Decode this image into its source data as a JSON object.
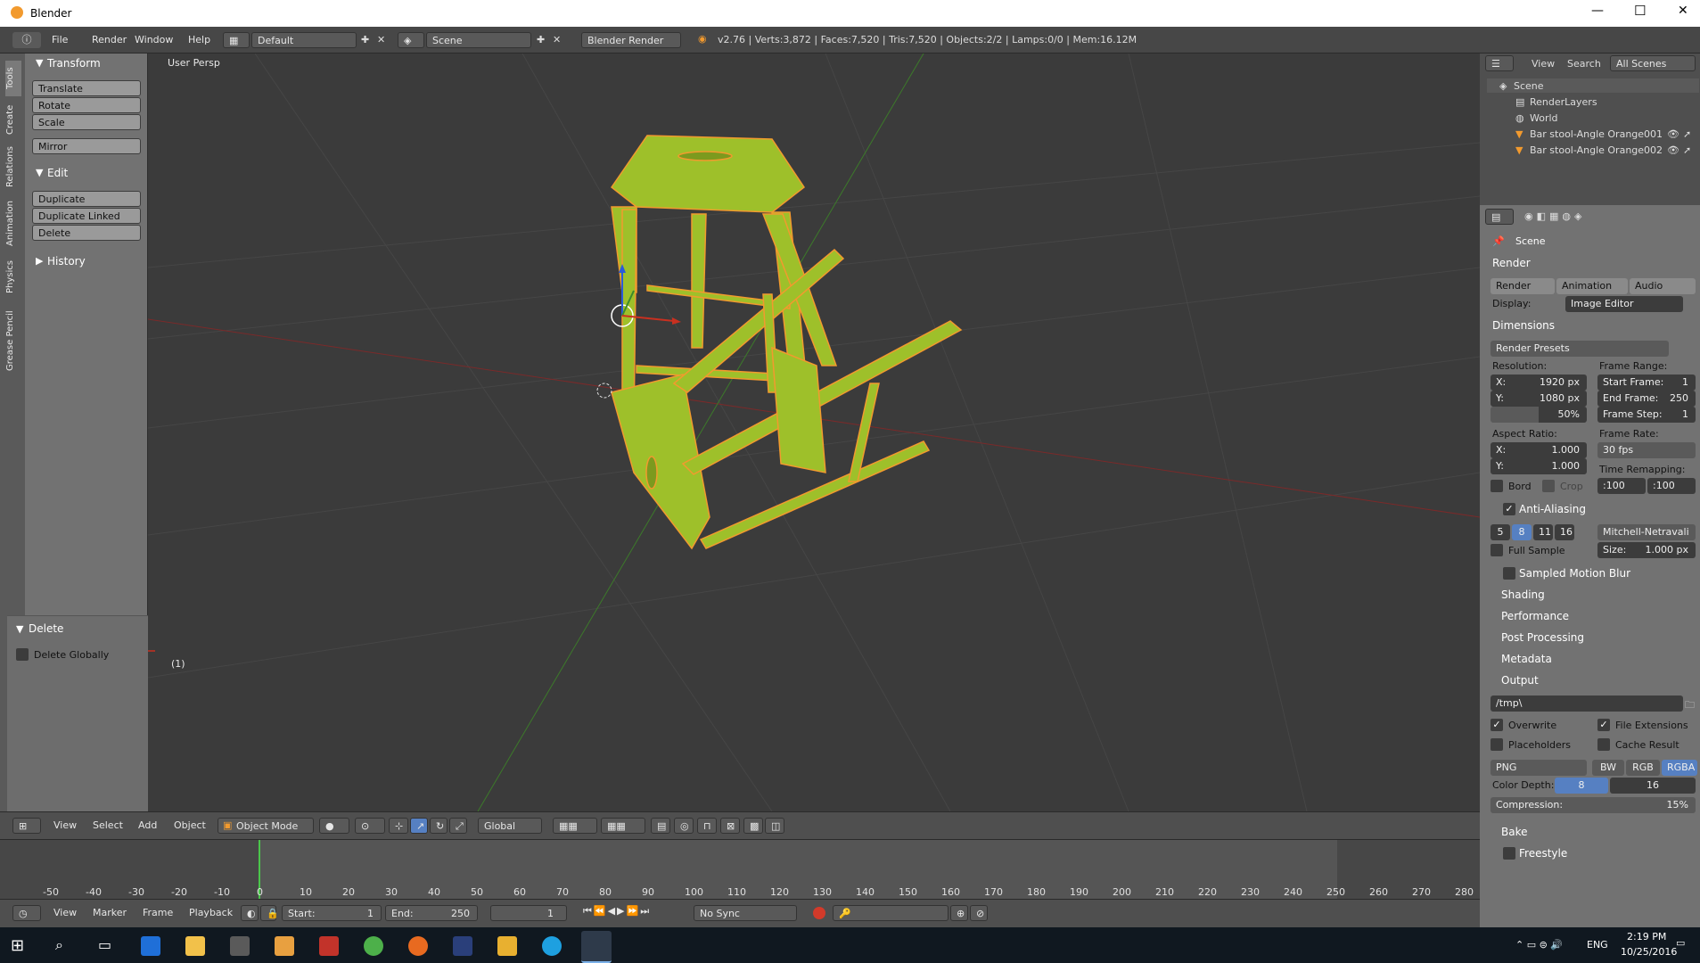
{
  "window": {
    "title": "Blender",
    "min": "—",
    "max": "☐",
    "close": "✕"
  },
  "topmenu": {
    "items": [
      "File",
      "Render",
      "Window",
      "Help"
    ],
    "layout": "Default",
    "scene": "Scene",
    "engine": "Blender Render",
    "stats": "v2.76 | Verts:3,872 | Faces:7,520 | Tris:7,520 | Objects:2/2 | Lamps:0/0 | Mem:16.12M"
  },
  "toolshelf": {
    "tabs": [
      "Tools",
      "Create",
      "Relations",
      "Animation",
      "Physics",
      "Grease Pencil"
    ],
    "transform_title": "Transform",
    "transform_buttons": [
      "Translate",
      "Rotate",
      "Scale"
    ],
    "mirror": "Mirror",
    "edit_title": "Edit",
    "edit_buttons": [
      "Duplicate",
      "Duplicate Linked",
      "Delete"
    ],
    "history_title": "History",
    "op_title": "Delete",
    "op_option": "Delete Globally"
  },
  "viewport": {
    "label": "User Persp",
    "frame": "(1)"
  },
  "vpfooter": {
    "items": [
      "View",
      "Select",
      "Add",
      "Object"
    ],
    "mode": "Object Mode",
    "orientation": "Global"
  },
  "timeline": {
    "ticks": [
      "-50",
      "-40",
      "-30",
      "-20",
      "-10",
      "0",
      "10",
      "20",
      "30",
      "40",
      "50",
      "60",
      "70",
      "80",
      "90",
      "100",
      "110",
      "120",
      "130",
      "140",
      "150",
      "160",
      "170",
      "180",
      "190",
      "200",
      "210",
      "220",
      "230",
      "240",
      "250",
      "260",
      "270",
      "280"
    ],
    "items": [
      "View",
      "Marker",
      "Frame",
      "Playback"
    ],
    "start_label": "Start:",
    "start": "1",
    "end_label": "End:",
    "end": "250",
    "current": "1",
    "sync": "No Sync"
  },
  "outliner": {
    "menu": [
      "View",
      "Search"
    ],
    "filter": "All Scenes",
    "items": [
      "Scene",
      "RenderLayers",
      "World",
      "Bar stool-Angle Orange001",
      "Bar stool-Angle Orange002"
    ]
  },
  "properties": {
    "context": "Scene",
    "render_section": "Render",
    "render_buttons": [
      "Render",
      "Animation",
      "Audio"
    ],
    "display_label": "Display:",
    "display_value": "Image Editor",
    "dimensions": "Dimensions",
    "presets": "Render Presets",
    "resolution_label": "Resolution:",
    "res_x": "X:",
    "res_x_val": "1920 px",
    "res_y": "Y:",
    "res_y_val": "1080 px",
    "res_pct": "50%",
    "frame_range_label": "Frame Range:",
    "start_frame": "Start Frame:",
    "start_frame_val": "1",
    "end_frame": "End Frame:",
    "end_frame_val": "250",
    "frame_step": "Frame Step:",
    "frame_step_val": "1",
    "aspect_label": "Aspect Ratio:",
    "asp_x": "X:",
    "asp_x_val": "1.000",
    "asp_y": "Y:",
    "asp_y_val": "1.000",
    "frame_rate_label": "Frame Rate:",
    "fps": "30 fps",
    "time_remap": "Time Remapping:",
    "remap_old": ":100",
    "remap_new": ":100",
    "bord": "Bord",
    "crop": "Crop",
    "aa": "Anti-Aliasing",
    "aa_samples": [
      "5",
      "8",
      "11",
      "16"
    ],
    "aa_filter": "Mitchell-Netravali",
    "full_sample": "Full Sample",
    "size_label": "Size:",
    "size_val": "1.000 px",
    "collapsed": [
      "Sampled Motion Blur",
      "Shading",
      "Performance",
      "Post Processing",
      "Metadata"
    ],
    "output": "Output",
    "path": "/tmp\\",
    "overwrite": "Overwrite",
    "file_ext": "File Extensions",
    "placeholders": "Placeholders",
    "cache": "Cache Result",
    "format": "PNG",
    "bw": "BW",
    "rgb": "RGB",
    "rgba": "RGBA",
    "color_depth": "Color Depth:",
    "depth8": "8",
    "depth16": "16",
    "compression_label": "Compression:",
    "compression": "15%",
    "bake": "Bake",
    "freestyle": "Freestyle"
  },
  "taskbar": {
    "lang": "ENG",
    "time": "2:19 PM",
    "date": "10/25/2016"
  },
  "colors": {
    "accent": "#5680c2",
    "mesh": "#9ec02a",
    "selected": "#f29a2e"
  }
}
